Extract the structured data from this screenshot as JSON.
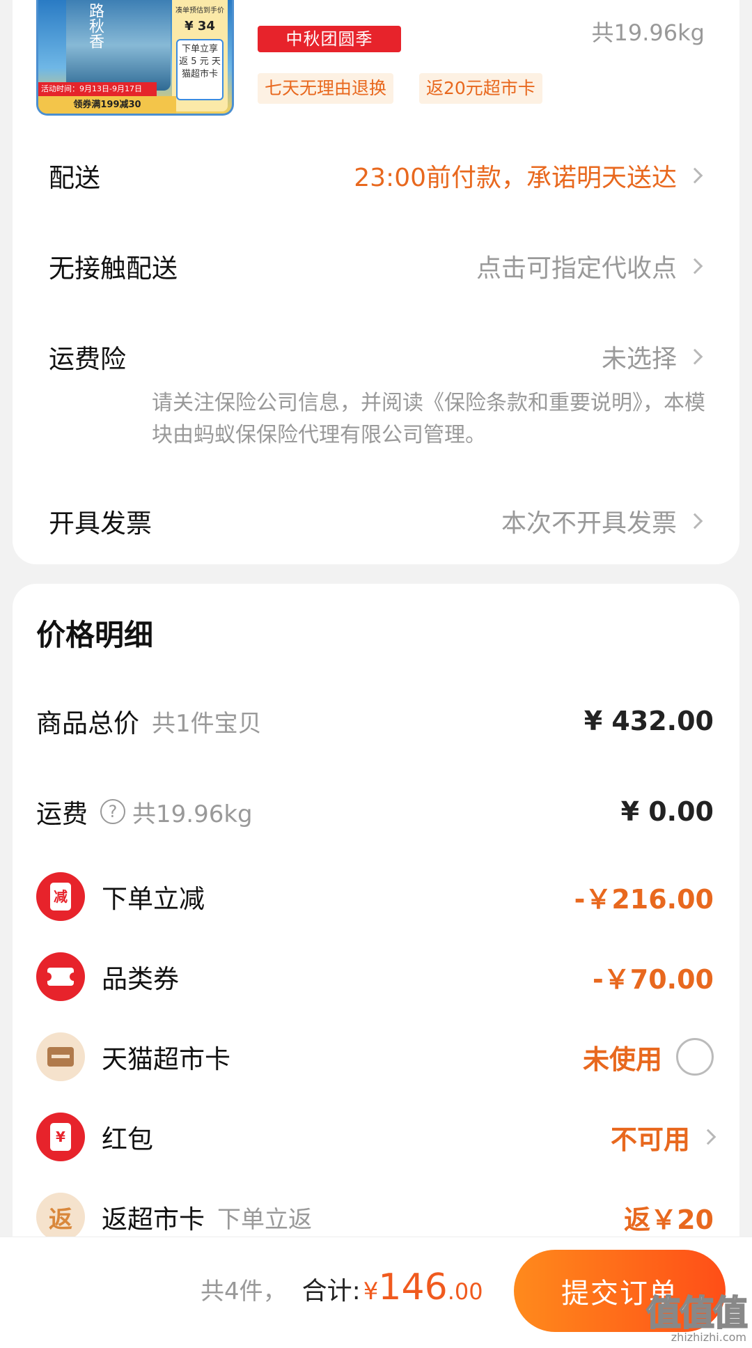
{
  "product": {
    "thumb_bag_text": "路秋香",
    "thumb_side_top": "凑单预估到手价",
    "thumb_side_price": "¥ 34",
    "thumb_side_box": "下单立享 返 5 元 天猫超市卡",
    "thumb_activity": "活动时间：9月13日-9月17日",
    "thumb_coupon": "领券满199减30",
    "festival_tag": "中秋团圆季",
    "weight": "共19.96kg",
    "tag_return": "七天无理由退换",
    "tag_card": "返20元超市卡"
  },
  "order_info": {
    "delivery_label": "配送",
    "delivery_value": "23:00前付款，承诺明天送达",
    "contactless_label": "无接触配送",
    "contactless_value": "点击可指定代收点",
    "insurance_label": "运费险",
    "insurance_value": "未选择",
    "insurance_note": "请关注保险公司信息，并阅读《保险条款和重要说明》，本模块由蚂蚁保保险代理有限公司管理。",
    "invoice_label": "开具发票",
    "invoice_value": "本次不开具发票"
  },
  "price_detail": {
    "title": "价格明细",
    "rows": [
      {
        "name": "商品总价",
        "sub": "共1件宝贝",
        "amount": "¥ 432.00"
      },
      {
        "name": "运费",
        "sub": "共19.96kg",
        "amount": "¥ 0.00"
      },
      {
        "name": "下单立减",
        "amount": "-￥216.00",
        "icon": "reduce-envelope-icon",
        "icon_text": "减"
      },
      {
        "name": "品类券",
        "amount": "-￥70.00",
        "icon": "ticket-icon"
      },
      {
        "name": "天猫超市卡",
        "amount": "未使用",
        "icon": "card-icon"
      },
      {
        "name": "红包",
        "amount": "不可用",
        "icon": "red-packet-icon",
        "icon_text": "¥"
      },
      {
        "name": "返超市卡",
        "sub": "下单立返",
        "amount": "返￥20",
        "icon": "return-icon",
        "icon_text": "返"
      }
    ],
    "help_glyph": "?"
  },
  "footer": {
    "count": "共4件，",
    "total_label": "合计:",
    "total_yen": "¥",
    "total_int": "146",
    "total_dec": ".00",
    "submit": "提交订单"
  },
  "watermark": {
    "logo": "值值值",
    "site": "zhizhizhi.com"
  },
  "colors": {
    "accent": "#e8681e",
    "brand_red": "#e7232b",
    "submit_gradient": [
      "#ff8a1c",
      "#ff4e17"
    ]
  }
}
